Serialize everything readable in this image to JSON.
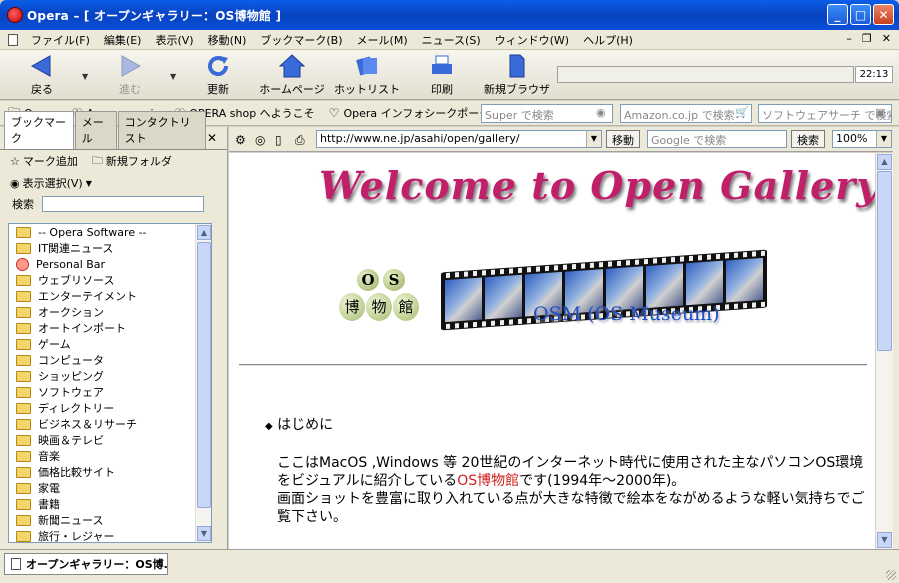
{
  "window": {
    "title": "Opera – [ オープンギャラリー：OS博物館 ]",
    "controls": [
      "minimize",
      "maximize",
      "close"
    ]
  },
  "menu": {
    "items": [
      "ファイル(F)",
      "編集(E)",
      "表示(V)",
      "移動(N)",
      "ブックマーク(B)",
      "メール(M)",
      "ニュース(S)",
      "ウィンドウ(W)",
      "ヘルプ(H)"
    ]
  },
  "toolbar": {
    "back": "戻る",
    "forward": "進む",
    "reload": "更新",
    "home": "ホームページ",
    "hotlist": "ホットリスト",
    "print": "印刷",
    "new_browser": "新規ブラウザ",
    "clock": "22:13"
  },
  "personalbar": {
    "links": [
      "Opera",
      "Amazon.co.jp",
      "OPERA shop へようこそ",
      "Opera インフォシークポータル"
    ],
    "search1_placeholder": "Super で検索",
    "search2_placeholder": "Amazon.co.jp で検索",
    "search3_placeholder": "ソフトウェアサーチ で検索"
  },
  "panel": {
    "tabs": [
      "ブックマーク",
      "メール",
      "コンタクトリスト"
    ],
    "add_mark": "マーク追加",
    "new_folder": "新規フォルダ",
    "view_select": "表示選択(V)",
    "search_label": "検索",
    "bookmarks": [
      "-- Opera Software --",
      "IT関連ニュース",
      "Personal Bar",
      "ウェブリソース",
      "エンターテイメント",
      "オークション",
      "オートインポート",
      "ゲーム",
      "コンピュータ",
      "ショッピング",
      "ソフトウェア",
      "ディレクトリー",
      "ビジネス＆リサーチ",
      "映画＆テレビ",
      "音楽",
      "価格比較サイト",
      "家電",
      "書籍",
      "新聞ニュース",
      "旅行・レジャー"
    ]
  },
  "addressbar": {
    "url": "http://www.ne.jp/asahi/open/gallery/",
    "go": "移動",
    "google_placeholder": "Google で検索",
    "search_button": "検索",
    "zoom": "100%"
  },
  "page": {
    "headline": "Welcome to Open Gallery",
    "badge_letters": [
      "O",
      "S"
    ],
    "badge_kanji": [
      "博",
      "物",
      "館"
    ],
    "osm_label": "OSM (OS Museum)",
    "section": "はじめに",
    "para_before": "ここはMacOS ,Windows 等 20世紀のインターネット時代に使用された主なパソコンOS環境をビジュアルに紹介している",
    "para_link": "OS博物館",
    "para_after": "です(1994年～2000年)。",
    "para2": "画面ショットを豊富に取り入れている点が大きな特徴で絵本をながめるような軽い気持ちでご覧下さい。"
  },
  "statusbar": {
    "tab_title": "オープンギャラリー：OS博..."
  }
}
